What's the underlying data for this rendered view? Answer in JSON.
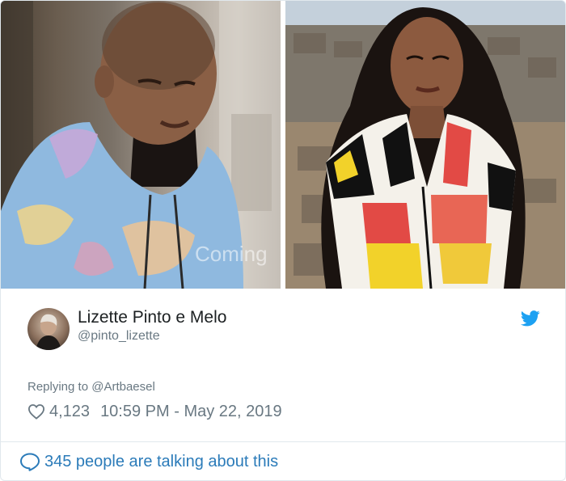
{
  "tweet": {
    "author_name": "Lizette Pinto e Melo",
    "author_handle": "@pinto_lizette",
    "replying_to": "Replying to @Artbaesel",
    "like_count": "4,123",
    "timestamp": "10:59 PM - May 22, 2019",
    "talking": "345 people are talking about this"
  },
  "images": {
    "left_caption": "Coming"
  },
  "icons": {
    "bird": "twitter-bird-icon",
    "heart": "heart-icon",
    "bubble": "speech-bubble-icon"
  },
  "colors": {
    "brand": "#1da1f2",
    "link": "#2b7bb9",
    "muted": "#697882",
    "text": "#1c2022"
  }
}
